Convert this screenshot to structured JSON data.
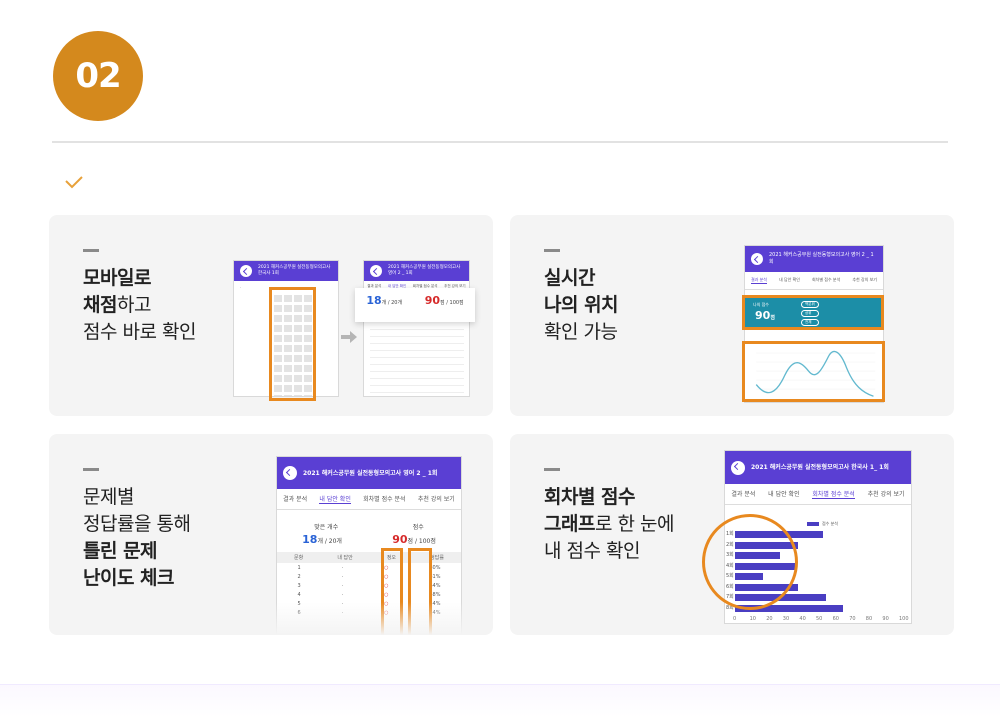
{
  "step": {
    "number": "02"
  },
  "colors": {
    "accent": "#d4891d",
    "brand": "#5a3fd3",
    "highlight": "#e8891f"
  },
  "cards": [
    {
      "lines": [
        [
          {
            "t": "모바일로",
            "b": true
          }
        ],
        [
          {
            "t": "채점",
            "b": true
          },
          {
            "t": "하고",
            "b": false
          }
        ],
        [
          {
            "t": "점수 바로 확인",
            "b": false
          }
        ]
      ]
    },
    {
      "lines": [
        [
          {
            "t": "실시간",
            "b": true
          }
        ],
        [
          {
            "t": "나의 위치",
            "b": true
          }
        ],
        [
          {
            "t": "확인 가능",
            "b": false
          }
        ]
      ]
    },
    {
      "lines": [
        [
          {
            "t": "문제별",
            "b": false
          }
        ],
        [
          {
            "t": "정답률을 통해",
            "b": false
          }
        ],
        [
          {
            "t": "틀린 문제",
            "b": true
          }
        ],
        [
          {
            "t": "난이도 체크",
            "b": true
          }
        ]
      ]
    },
    {
      "lines": [
        [
          {
            "t": "회차별 점수",
            "b": true
          }
        ],
        [
          {
            "t": "그래프",
            "b": true
          },
          {
            "t": "로 한 눈에",
            "b": false
          }
        ],
        [
          {
            "t": "내 점수 확인",
            "b": false
          }
        ]
      ]
    }
  ],
  "mock": {
    "exam_title_1": "2021 해커스공무원 실전동형모의고사 한국사 1회",
    "exam_title_2": "2021 해커스공무원 실전동형모의고사 영어 2 _ 1회",
    "exam_title_3": "2021 해커스공무원 실전동형모의고사 한국사 1_ 1회",
    "tabs": [
      "결과 분석",
      "내 답안 확인",
      "회차별 점수 분석",
      "추천 강의 보기"
    ],
    "correct_label": "맞은 개수",
    "correct_value": "18",
    "correct_total": "개 / 20개",
    "score_label": "점수",
    "score_value": "90",
    "score_total": "점 / 100점",
    "my_score_label": "나의 점수",
    "my_score_value": "90",
    "my_score_unit": "점",
    "rank_tags": [
      "백분위",
      "상위",
      "전체"
    ],
    "legend": "점수 분석",
    "table_cols": [
      "문항",
      "내 답안",
      "정오",
      "정답률"
    ],
    "rates": [
      "80%",
      "81%",
      "64%",
      "48%",
      "54%",
      "54%"
    ],
    "bar_labels": [
      "1회",
      "2회",
      "3회",
      "4회",
      "5회",
      "6회",
      "7회",
      "8회"
    ],
    "bar_values": [
      53,
      38,
      27,
      37,
      17,
      38,
      55,
      65
    ],
    "x_ticks": [
      "0",
      "10",
      "20",
      "30",
      "40",
      "50",
      "60",
      "70",
      "80",
      "90",
      "100"
    ]
  }
}
